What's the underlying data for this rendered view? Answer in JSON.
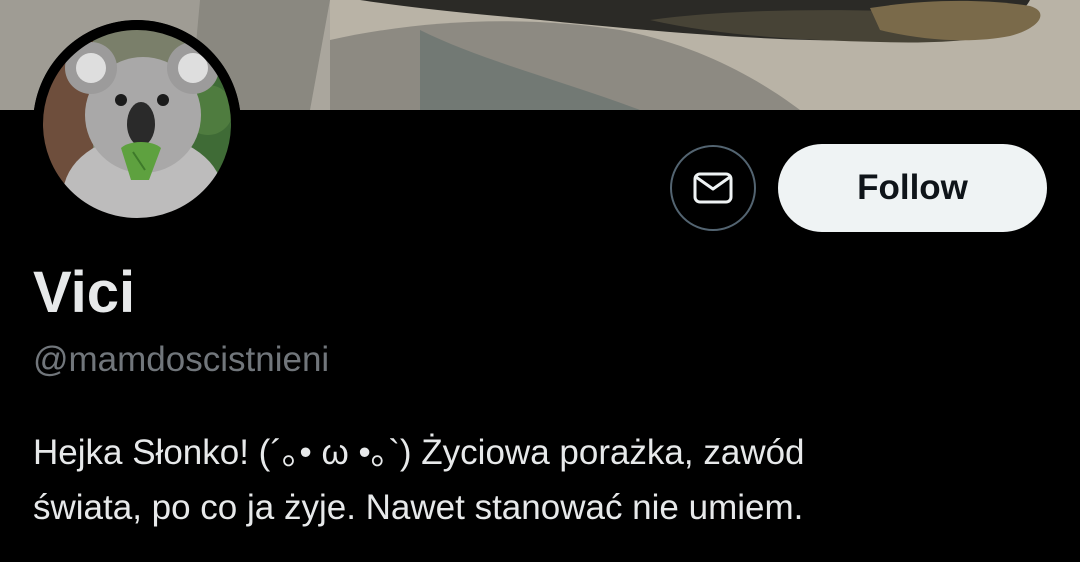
{
  "profile": {
    "display_name": "Vici",
    "handle": "@mamdoscistnieni",
    "bio_lines": [
      "Hejka Słonko! (´｡• ω •｡`)  Życiowa porażka, zawód",
      "świata, po co ja żyje. Nawet stanować nie umiem."
    ]
  },
  "actions": {
    "follow_label": "Follow",
    "message_icon": "envelope-icon"
  },
  "colors": {
    "background": "#000000",
    "primary_text": "#e7e9ea",
    "secondary_text": "#71767b",
    "follow_bg": "#eff3f4",
    "follow_text": "#0f1419",
    "button_border": "#536471"
  }
}
